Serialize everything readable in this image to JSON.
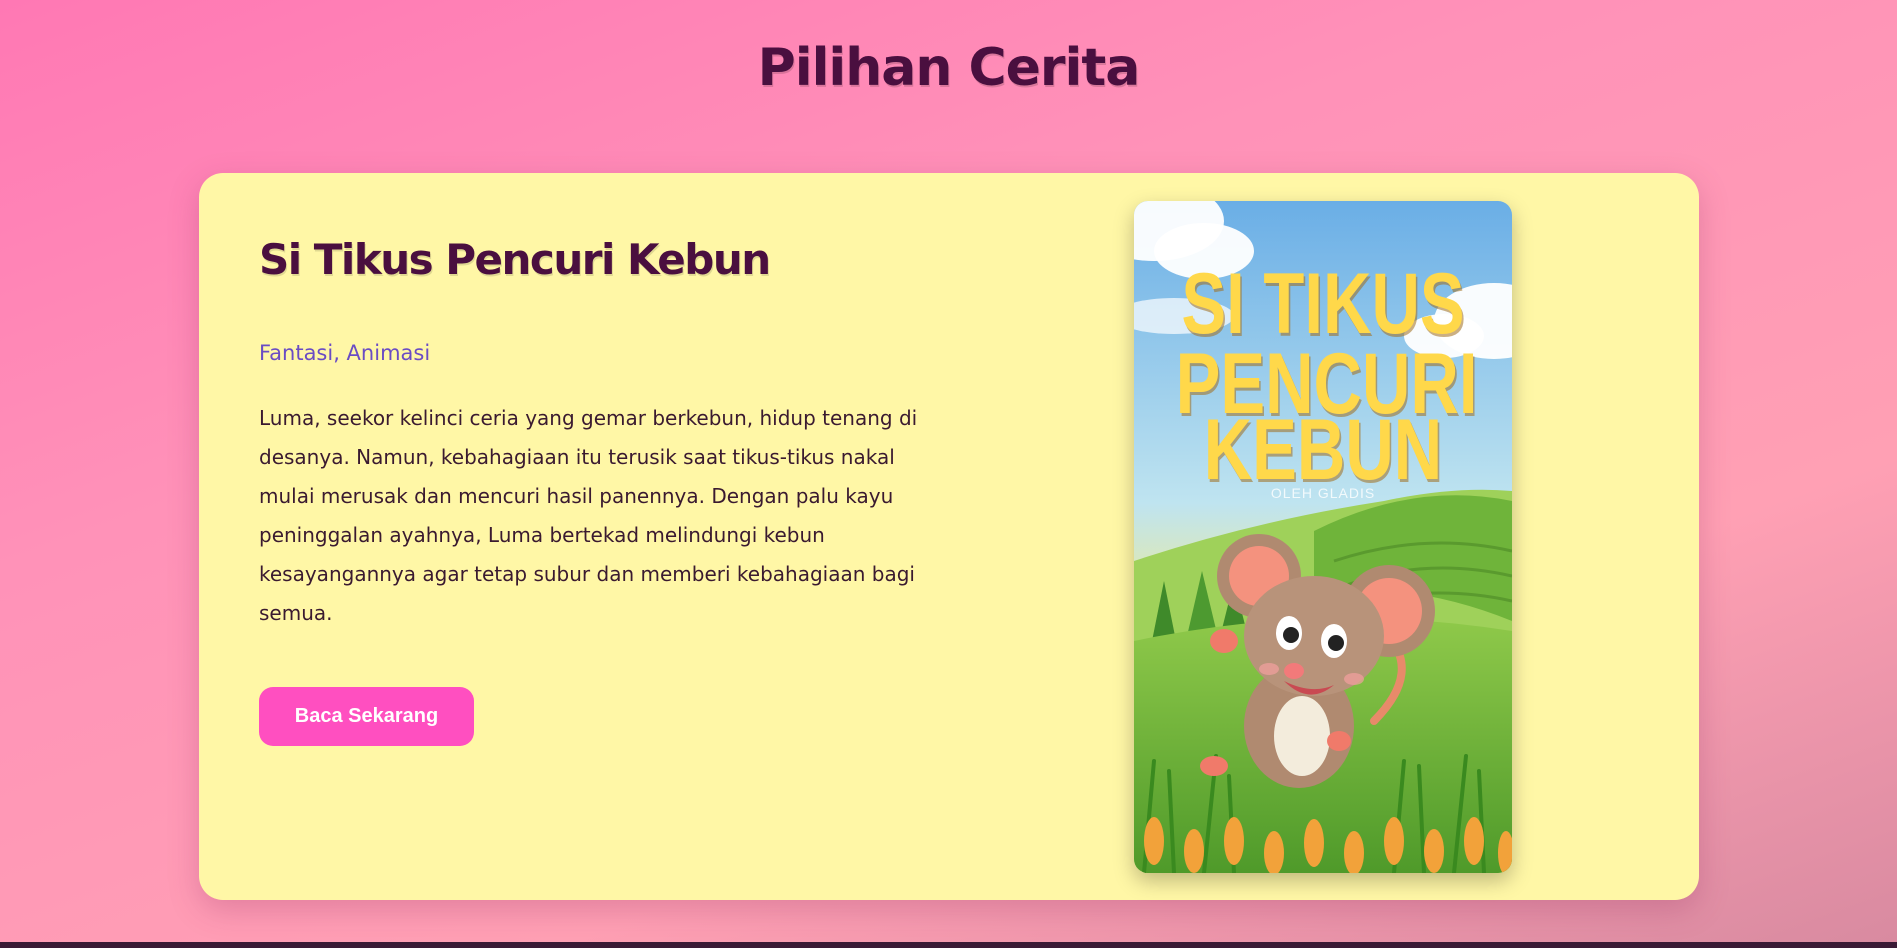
{
  "page": {
    "title": "Pilihan Cerita"
  },
  "story": {
    "title": "Si Tikus Pencuri Kebun",
    "genre": "Fantasi, Animasi",
    "description": "Luma, seekor kelinci ceria yang gemar berkebun, hidup tenang di desanya. Namun, kebahagiaan itu terusik saat tikus-tikus nakal mulai merusak dan mencuri hasil panennya. Dengan palu kayu peninggalan ayahnya, Luma bertekad melindungi kebun kesayangannya agar tetap subur dan memberi kebahagiaan bagi semua.",
    "read_button_label": "Baca Sekarang",
    "cover": {
      "title_line1": "SI TIKUS",
      "title_line2": "PENCURI",
      "title_line3": "KEBUN",
      "author": "OLEH GLADIS"
    }
  },
  "colors": {
    "title_text": "#4a0f3f",
    "card_background": "#fff7a6",
    "genre_text": "#6a4cc4",
    "button_background": "#ff4fc0",
    "cover_title": "#ffd84a"
  }
}
